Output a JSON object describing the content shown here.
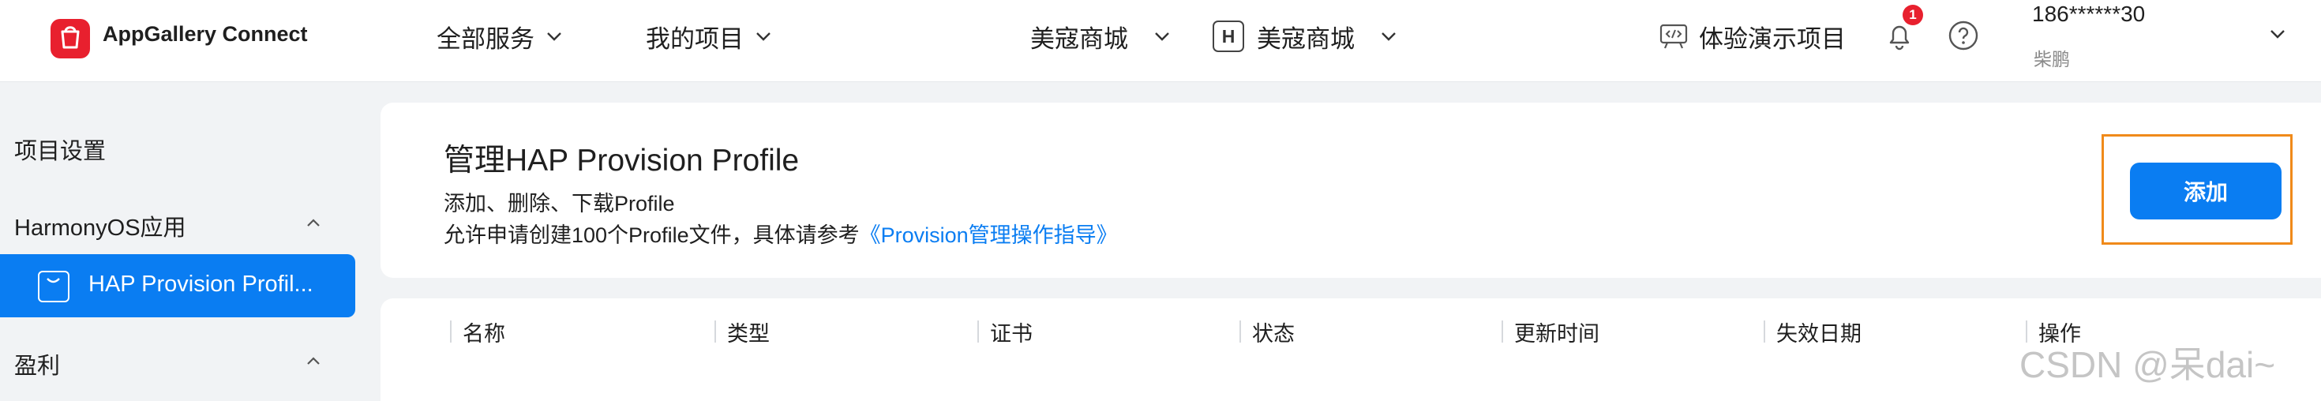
{
  "header": {
    "brand": "AppGallery Connect",
    "nav": {
      "all_services": "全部服务",
      "my_projects": "我的项目",
      "project": "美寇商城",
      "app_badge": "H",
      "app": "美寇商城"
    },
    "demo_project": "体验演示项目",
    "notification_count": "1",
    "user": {
      "id": "186******30",
      "name": "柴鹏"
    }
  },
  "sidebar": {
    "project_settings": "项目设置",
    "groups": [
      {
        "label": "HarmonyOS应用",
        "items": [
          {
            "label": "HAP Provision Profil..."
          }
        ]
      },
      {
        "label": "盈利"
      }
    ]
  },
  "main": {
    "title": "管理HAP Provision Profile",
    "subtitle": "添加、删除、下载Profile",
    "description": "允许申请创建100个Profile文件，具体请参考",
    "guide_link": "《Provision管理操作指导》",
    "add_button": "添加",
    "table": {
      "columns": [
        "名称",
        "类型",
        "证书",
        "状态",
        "更新时间",
        "失效日期",
        "操作"
      ]
    }
  },
  "watermark": "CSDN @呆dai~",
  "colors": {
    "accent": "#0a7df2",
    "brand_red": "#e8202e",
    "highlight_outline": "#f08a1a",
    "background": "#f1f3f5"
  }
}
